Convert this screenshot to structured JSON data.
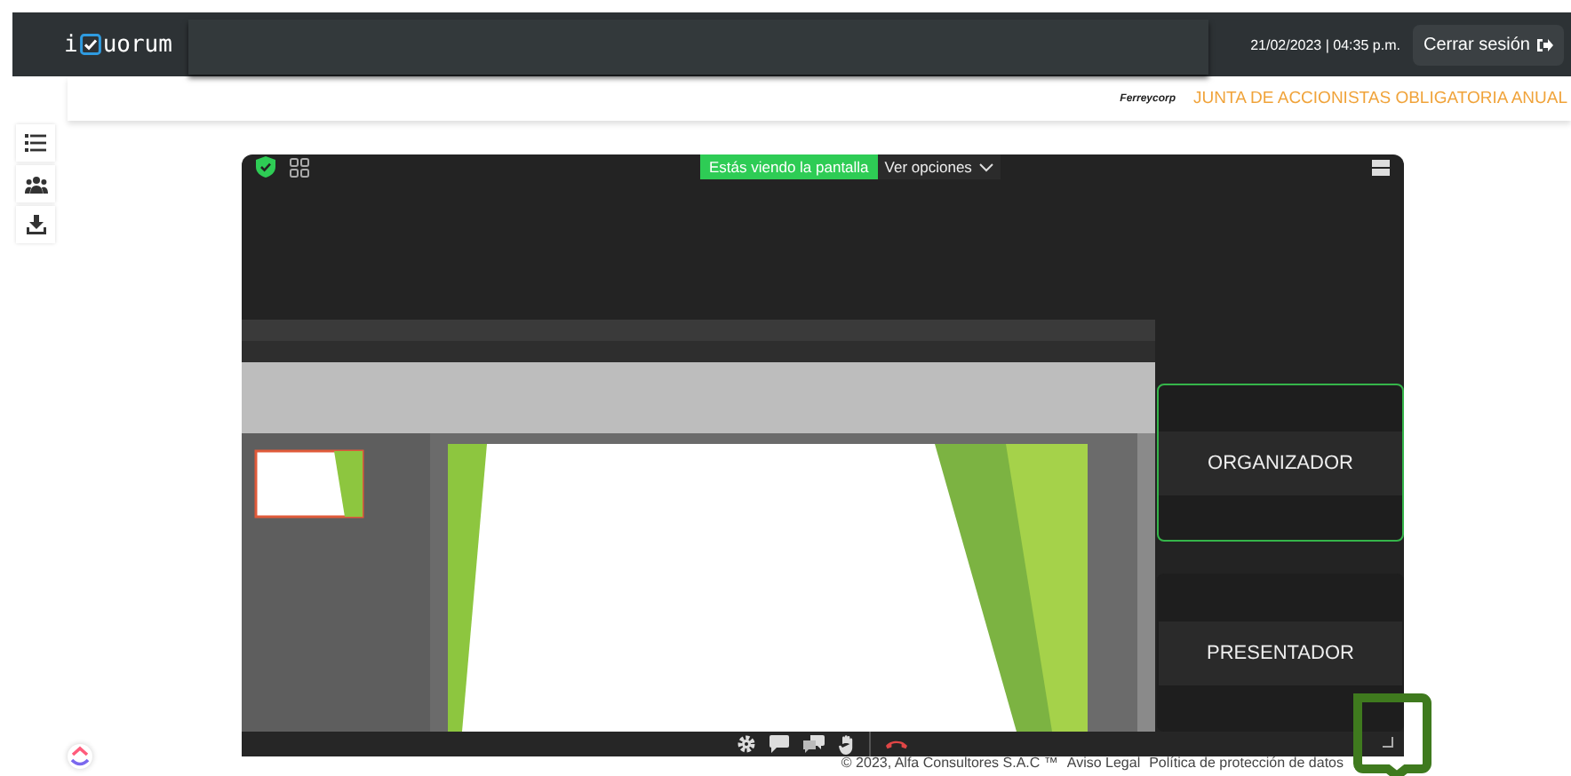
{
  "header": {
    "logo_start": "i",
    "logo_end": "uorum",
    "date_time": "21/02/2023 | 04:35 p.m.",
    "logout_button": "Cerrar sesión"
  },
  "subheader": {
    "company": "Ferreycorp",
    "event_title": "JUNTA DE ACCIONISTAS OBLIGATORIA ANUAL"
  },
  "stage": {
    "sharing_banner": "Estás viendo la pantalla",
    "options_menu": "Ver opciones",
    "participants": [
      {
        "name": "ORGANIZADOR",
        "speaking": true
      },
      {
        "name": "PRESENTADOR",
        "speaking": false
      }
    ]
  },
  "footer": {
    "copyright": "© 2023, Alfa Consultores S.A.C ™",
    "links": [
      "Aviso Legal",
      "Política de protección de datos"
    ]
  }
}
